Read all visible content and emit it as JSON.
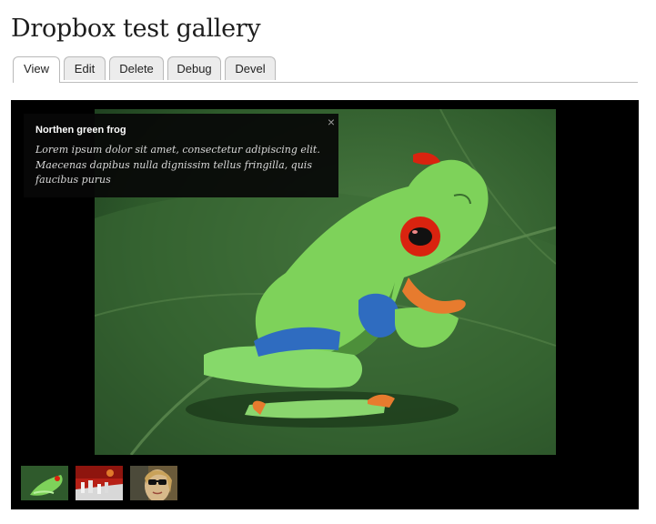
{
  "page": {
    "title": "Dropbox test gallery"
  },
  "tabs": [
    {
      "label": "View",
      "active": true
    },
    {
      "label": "Edit",
      "active": false
    },
    {
      "label": "Delete",
      "active": false
    },
    {
      "label": "Debug",
      "active": false
    },
    {
      "label": "Devel",
      "active": false
    }
  ],
  "gallery": {
    "caption": {
      "title": "Northen green frog",
      "description": "Lorem ipsum dolor sit amet, consectetur adipiscing elit. Maecenas dapibus nulla dignissim tellus fringilla, quis faucibus purus",
      "close_icon": "×"
    },
    "thumbnails": [
      {
        "icon": "frog-thumbnail"
      },
      {
        "icon": "chess-thumbnail"
      },
      {
        "icon": "woman-sunglasses-thumbnail"
      }
    ]
  },
  "colors": {
    "background": "#ffffff",
    "gallery_bg": "#000000",
    "frog_green": "#7ed25a",
    "leaf_green": "#2f5a2c"
  }
}
